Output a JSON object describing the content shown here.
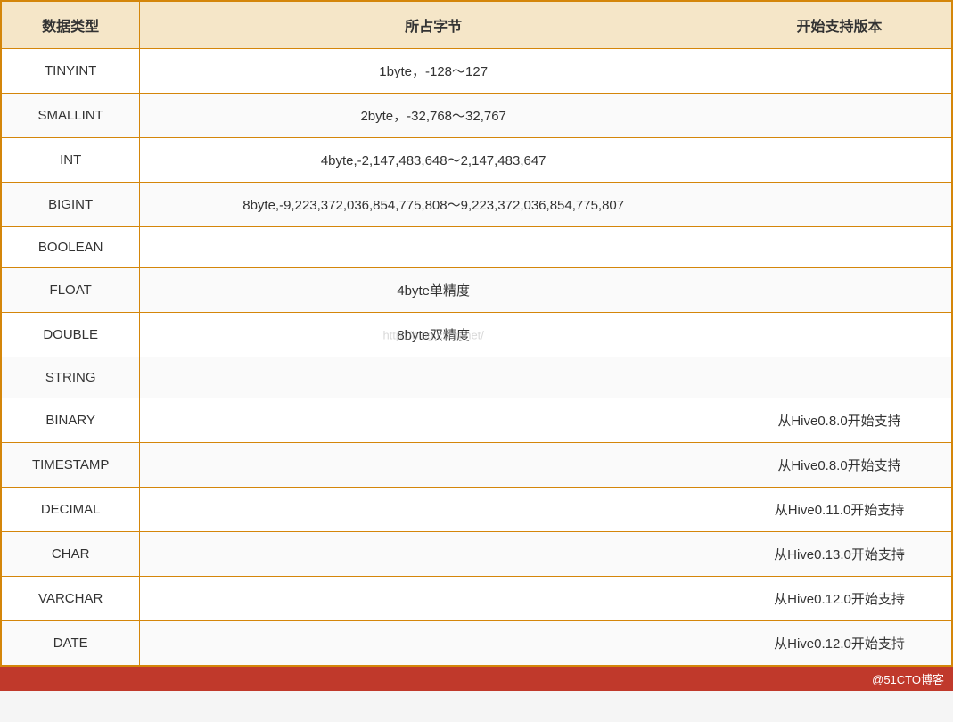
{
  "table": {
    "headers": {
      "type": "数据类型",
      "bytes": "所占字节",
      "version": "开始支持版本"
    },
    "rows": [
      {
        "type": "TINYINT",
        "bytes": "1byte，-128～127",
        "version": ""
      },
      {
        "type": "SMALLINT",
        "bytes": "2byte，-32,768～32,767",
        "version": ""
      },
      {
        "type": "INT",
        "bytes": "4byte,-2,147,483,648～2,147,483,647",
        "version": ""
      },
      {
        "type": "BIGINT",
        "bytes": "8byte,-9,223,372,036,854,775,808～9,223,372,036,854,775,807",
        "version": ""
      },
      {
        "type": "BOOLEAN",
        "bytes": "",
        "version": ""
      },
      {
        "type": "FLOAT",
        "bytes": "4byte单精度",
        "version": ""
      },
      {
        "type": "DOUBLE",
        "bytes": "8byte双精度",
        "version": ""
      },
      {
        "type": "STRING",
        "bytes": "",
        "version": ""
      },
      {
        "type": "BINARY",
        "bytes": "",
        "version": "从Hive0.8.0开始支持"
      },
      {
        "type": "TIMESTAMP",
        "bytes": "",
        "version": "从Hive0.8.0开始支持"
      },
      {
        "type": "DECIMAL",
        "bytes": "",
        "version": "从Hive0.11.0开始支持"
      },
      {
        "type": "CHAR",
        "bytes": "",
        "version": "从Hive0.13.0开始支持"
      },
      {
        "type": "VARCHAR",
        "bytes": "",
        "version": "从Hive0.12.0开始支持"
      },
      {
        "type": "DATE",
        "bytes": "",
        "version": "从Hive0.12.0开始支持"
      }
    ],
    "watermark": "http://blog.csdn.net/"
  },
  "footer": {
    "text": "@51CTO博客"
  }
}
